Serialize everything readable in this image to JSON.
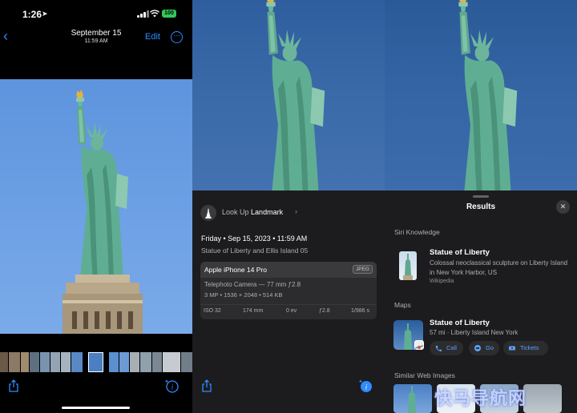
{
  "panel1": {
    "status": {
      "time": "1:26",
      "battery": "100"
    },
    "nav": {
      "date": "September 15",
      "time": "11:59 AM",
      "edit_label": "Edit"
    }
  },
  "panel2": {
    "lookup": {
      "prefix": "Look Up",
      "label": "Landmark"
    },
    "date_line": "Friday • Sep 15, 2023 • 11:59 AM",
    "caption": "Statue of Liberty and Ellis Island 05",
    "camera": {
      "model": "Apple iPhone 14 Pro",
      "format": "JPEG",
      "lens": "Telephoto Camera — 77 mm ƒ2.8",
      "specs": "3 MP • 1536 × 2048 • 514 KB",
      "exif": [
        "ISO 32",
        "174 mm",
        "0 ev",
        "ƒ2.8",
        "1/986 s"
      ]
    }
  },
  "panel3": {
    "title": "Results",
    "siri": {
      "heading": "Siri Knowledge",
      "name": "Statue of Liberty",
      "description": "Colossal neoclassical sculpture on Liberty Island in New York Harbor, US",
      "source": "Wikipedia"
    },
    "maps": {
      "heading": "Maps",
      "name": "Statue of Liberty",
      "subtitle": "57 mi · Liberty Island New York",
      "actions": [
        "Call",
        "Go",
        "Tickets"
      ]
    },
    "similar": {
      "heading": "Similar Web Images"
    },
    "watermark": "快马导航网"
  },
  "colors": {
    "accent": "#2f8cff",
    "battery": "#34c759",
    "sky": "#6fa2e6",
    "statue": "#5fae94"
  }
}
